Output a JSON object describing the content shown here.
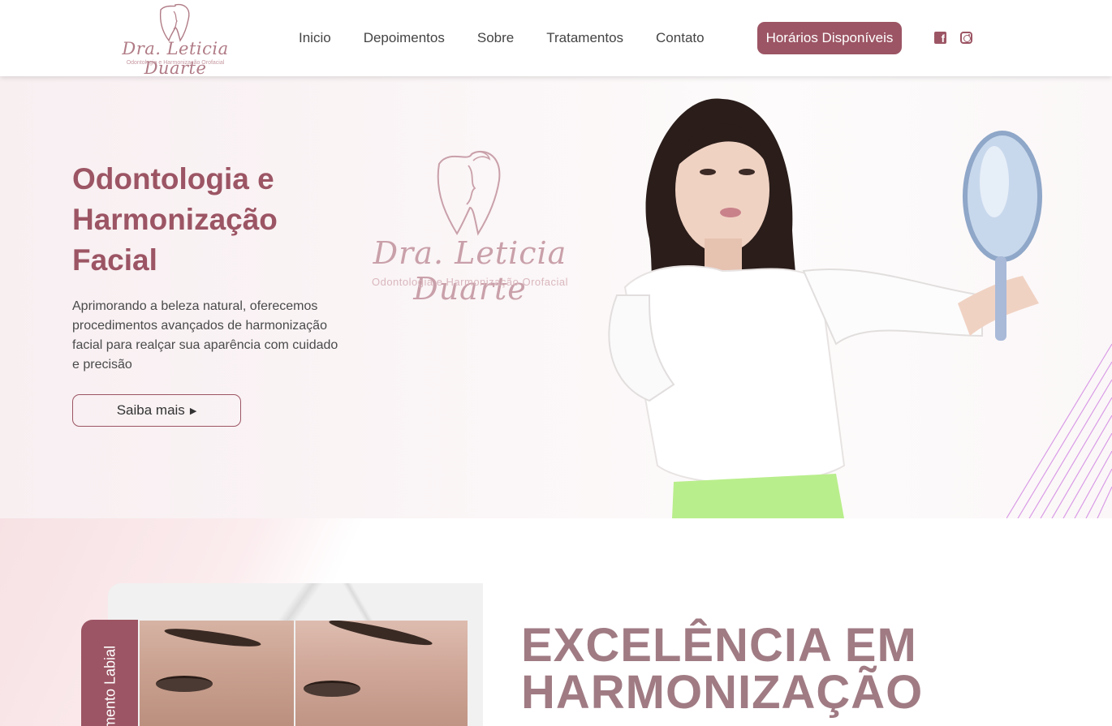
{
  "header": {
    "logo": {
      "name": "Dra. Leticia Duarte",
      "subtitle": "Odontologia e Harmonização Orofacial"
    },
    "nav": [
      "Inicio",
      "Depoimentos",
      "Sobre",
      "Tratamentos",
      "Contato"
    ],
    "cta_label": "Horários Disponíveis",
    "social": {
      "facebook_glyph": "f",
      "icons": [
        "facebook-icon",
        "instagram-icon"
      ]
    }
  },
  "hero": {
    "title": "Odontologia e Harmonização Facial",
    "description": "Aprimorando a beleza natural, oferecemos procedimentos avançados de harmonização facial para realçar sua aparência com cuidado e precisão",
    "button_label": "Saiba mais",
    "button_icon": "caret-right-icon",
    "center_logo": {
      "name": "Dra. Leticia Duarte",
      "subtitle": "Odontologia e Harmonização Orofacial"
    }
  },
  "section2": {
    "photo_label": "mento Labial",
    "title": "EXCELÊNCIA EM HARMONIZAÇÃO"
  },
  "colors": {
    "accent": "#9c5564",
    "title_muted": "#a07b84",
    "logo_pink": "#c9a0aa",
    "hero_bg": "#f8eff1"
  }
}
